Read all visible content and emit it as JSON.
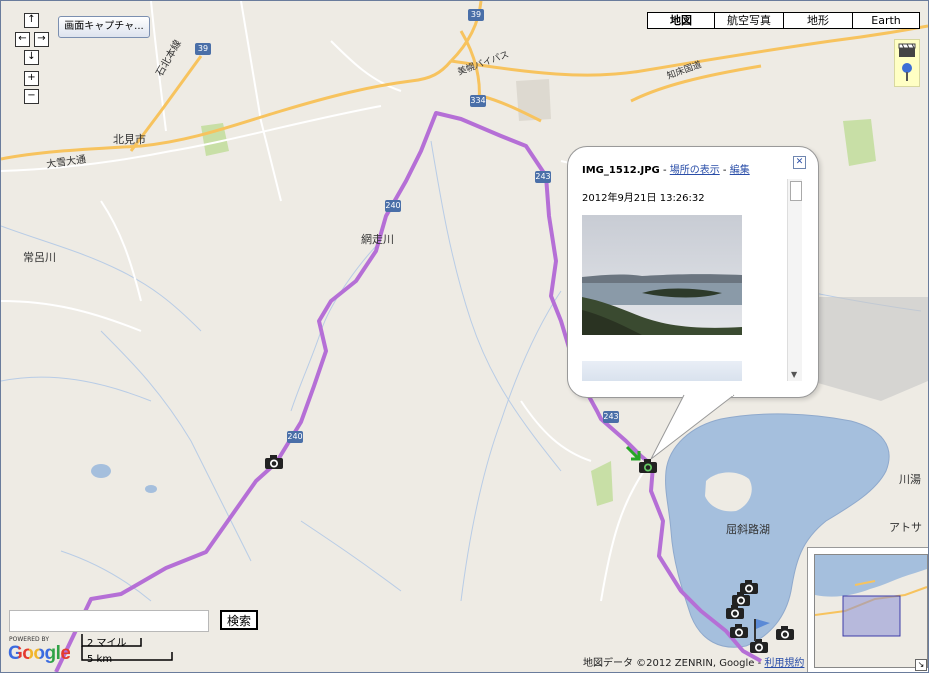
{
  "controls": {
    "pan_up": "↑",
    "pan_left": "←",
    "pan_right": "→",
    "pan_down": "↓",
    "zoom_in": "+",
    "zoom_out": "−",
    "capture_button": "画面キャプチャ..."
  },
  "map_types": [
    {
      "label": "地図",
      "active": true
    },
    {
      "label": "航空写真",
      "active": false
    },
    {
      "label": "地形",
      "active": false
    },
    {
      "label": "Earth",
      "active": false
    }
  ],
  "side_icons": [
    "clapperboard-icon",
    "pin-icon"
  ],
  "place_labels": {
    "kitami": "北見市",
    "ishikita": "石北本線",
    "taisetsu": "大雪大通",
    "tokoro": "常呂川",
    "abashiri": "網走川",
    "kussharo": "屈斜路湖",
    "kawayu": "川湯",
    "atosa": "アトサ",
    "bypass": "美幌バイパス",
    "shiretoko": "知床国道"
  },
  "road_shields": [
    "39",
    "39",
    "334",
    "243",
    "240",
    "240",
    "243"
  ],
  "info_window": {
    "filename": "IMG_1512.JPG",
    "sep": " - ",
    "show_location": "場所の表示",
    "edit": "編集",
    "datetime": "2012年9月21日  13:26:32"
  },
  "search": {
    "value": "",
    "button": "検索"
  },
  "footer": {
    "powered_by": "POWERED BY",
    "logo": "Google",
    "scale_miles": "2 マイル",
    "scale_km": "5 km",
    "copyright": "地図データ ©2012 ZENRIN, Google - ",
    "terms": "利用規約"
  },
  "colors": {
    "route": "#b56fd6",
    "water": "#a5bfdd",
    "park": "#c8dfa6",
    "highway": "#f7c35e",
    "link": "#2a4ea8"
  }
}
